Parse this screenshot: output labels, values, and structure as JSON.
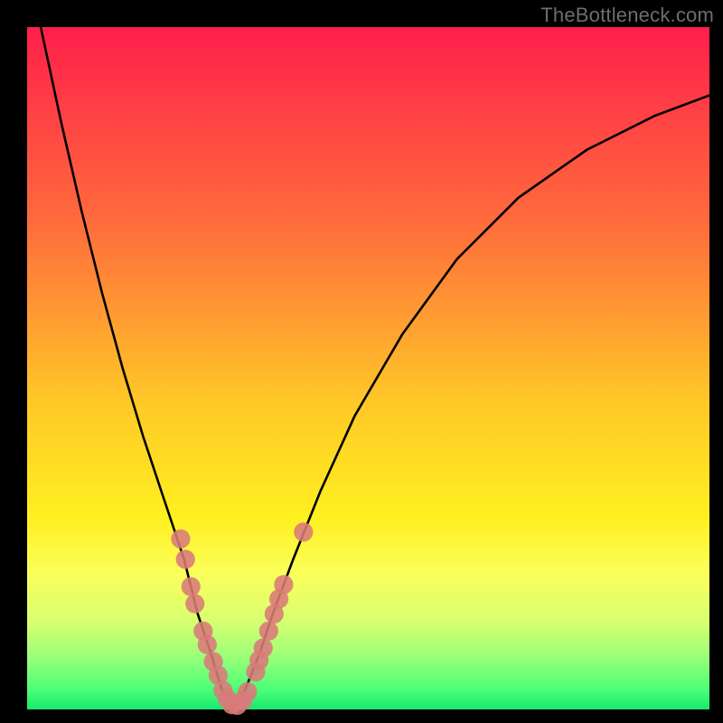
{
  "watermark": "TheBottleneck.com",
  "chart_data": {
    "type": "line",
    "title": "",
    "xlabel": "",
    "ylabel": "",
    "xlim": [
      0,
      100
    ],
    "ylim": [
      0,
      100
    ],
    "grid": false,
    "series": [
      {
        "name": "bottleneck-curve",
        "color": "#000000",
        "x": [
          2,
          5,
          8,
          11,
          14,
          17,
          20,
          23,
          25,
          27,
          28.5,
          30,
          32,
          34,
          36,
          39,
          43,
          48,
          55,
          63,
          72,
          82,
          92,
          100
        ],
        "values": [
          100,
          86,
          73,
          61,
          50,
          40,
          31,
          22,
          14,
          8,
          3,
          0,
          3,
          8,
          14,
          22,
          32,
          43,
          55,
          66,
          75,
          82,
          87,
          90
        ]
      }
    ],
    "scatter": [
      {
        "name": "data-points",
        "color": "#d97a7a",
        "radius_frac": 0.014,
        "points": [
          {
            "x": 22.5,
            "y": 25
          },
          {
            "x": 23.2,
            "y": 22
          },
          {
            "x": 24.0,
            "y": 18
          },
          {
            "x": 24.6,
            "y": 15.5
          },
          {
            "x": 25.8,
            "y": 11.5
          },
          {
            "x": 26.4,
            "y": 9.5
          },
          {
            "x": 27.3,
            "y": 7
          },
          {
            "x": 28.0,
            "y": 5
          },
          {
            "x": 28.7,
            "y": 2.8
          },
          {
            "x": 29.3,
            "y": 1.6
          },
          {
            "x": 30.0,
            "y": 0.7
          },
          {
            "x": 30.8,
            "y": 0.6
          },
          {
            "x": 31.6,
            "y": 1.3
          },
          {
            "x": 32.3,
            "y": 2.6
          },
          {
            "x": 33.5,
            "y": 5.5
          },
          {
            "x": 34.0,
            "y": 7.2
          },
          {
            "x": 34.6,
            "y": 9.0
          },
          {
            "x": 35.4,
            "y": 11.5
          },
          {
            "x": 36.2,
            "y": 14.0
          },
          {
            "x": 36.9,
            "y": 16.2
          },
          {
            "x": 37.6,
            "y": 18.3
          },
          {
            "x": 40.5,
            "y": 26
          }
        ]
      }
    ]
  }
}
